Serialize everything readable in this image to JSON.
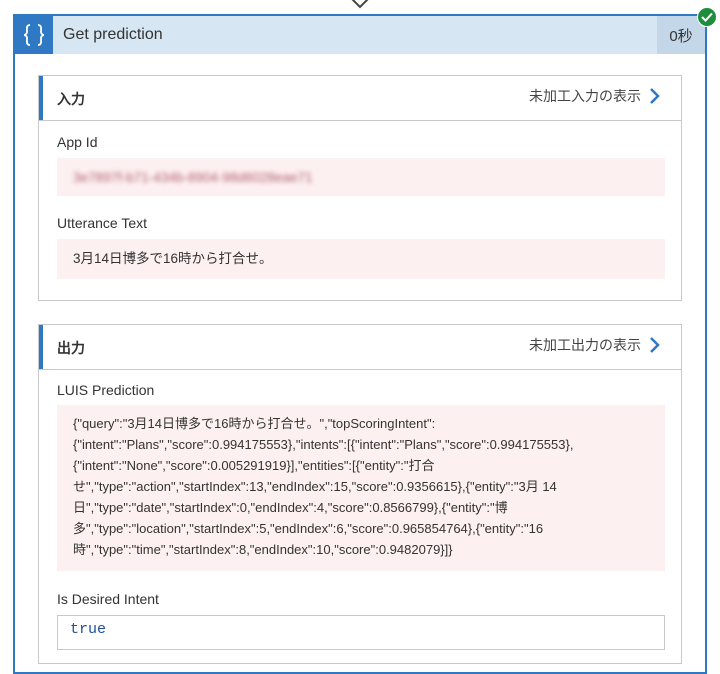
{
  "action": {
    "title": "Get prediction",
    "duration": "0秒",
    "icon": "curly-braces-icon"
  },
  "inputs": {
    "header": "入力",
    "raw_link": "未加工入力の表示",
    "fields": [
      {
        "label": "App Id",
        "value": "3e7897f-b71-434b-8904-98d6028eae71"
      },
      {
        "label": "Utterance Text",
        "value": "3月14日博多で16時から打合せ。"
      }
    ]
  },
  "outputs": {
    "header": "出力",
    "raw_link": "未加工出力の表示",
    "luis_label": "LUIS Prediction",
    "luis_lines": [
      "{\"query\":\"3月14日博多で16時から打合せ。\",\"topScoringIntent\":",
      "{\"intent\":\"Plans\",\"score\":0.994175553},\"intents\":[{\"intent\":\"Plans\",\"score\":0.994175553},",
      "{\"intent\":\"None\",\"score\":0.005291919}],\"entities\":[{\"entity\":\"打合",
      "せ\",\"type\":\"action\",\"startIndex\":13,\"endIndex\":15,\"score\":0.9356615},{\"entity\":\"3月 14",
      "日\",\"type\":\"date\",\"startIndex\":0,\"endIndex\":4,\"score\":0.8566799},{\"entity\":\"博",
      "多\",\"type\":\"location\",\"startIndex\":5,\"endIndex\":6,\"score\":0.965854764},{\"entity\":\"16",
      "時\",\"type\":\"time\",\"startIndex\":8,\"endIndex\":10,\"score\":0.9482079}]}"
    ],
    "intent_label": "Is Desired Intent",
    "intent_value": "true"
  },
  "colors": {
    "accent": "#2f79c4",
    "header_bg": "#d6e6f3",
    "success": "#1e8d3e",
    "value_bg": "#fdf0f0"
  }
}
